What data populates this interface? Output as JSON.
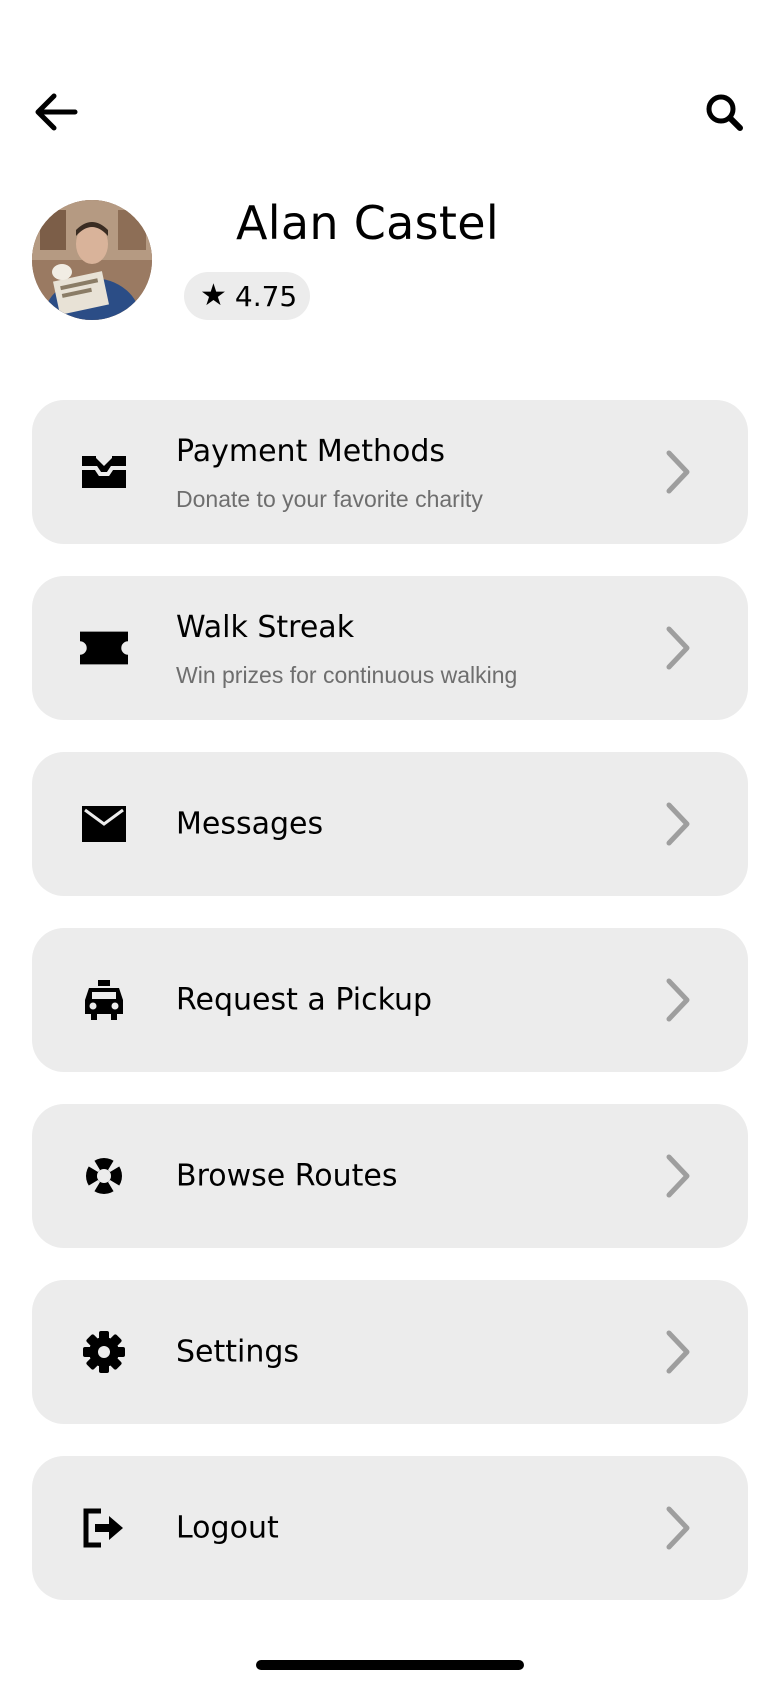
{
  "header": {
    "back_icon": "arrow-left-icon",
    "search_icon": "search-icon"
  },
  "profile": {
    "name": "Alan Castel",
    "rating": "4.75",
    "rating_icon": "star-icon",
    "avatar": "user-avatar-photo"
  },
  "menu": {
    "items": [
      {
        "title": "Payment Methods",
        "subtitle": "Donate to your favorite charity",
        "icon": "inbox-tray-icon"
      },
      {
        "title": "Walk Streak",
        "subtitle": "Win prizes for continuous walking",
        "icon": "ticket-icon"
      },
      {
        "title": "Messages",
        "subtitle": "",
        "icon": "envelope-icon"
      },
      {
        "title": "Request a Pickup",
        "subtitle": "",
        "icon": "taxi-icon"
      },
      {
        "title": "Browse Routes",
        "subtitle": "",
        "icon": "lifebuoy-icon"
      },
      {
        "title": "Settings",
        "subtitle": "",
        "icon": "gear-icon"
      },
      {
        "title": "Logout",
        "subtitle": "",
        "icon": "sign-out-icon"
      }
    ],
    "chevron_icon": "chevron-right-icon"
  },
  "colors": {
    "card_bg": "#ececec",
    "subtitle": "#6e6e6e",
    "chevron": "#9e9e9e",
    "text": "#000000"
  }
}
